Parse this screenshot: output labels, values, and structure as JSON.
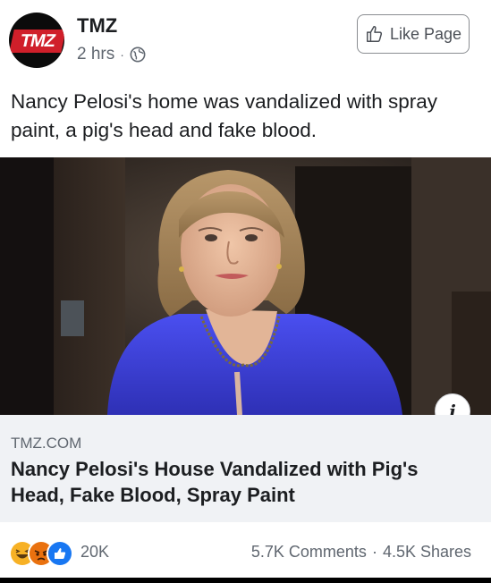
{
  "header": {
    "page_name": "TMZ",
    "avatar_logo": "TMZ",
    "timestamp": "2 hrs",
    "separator": "·",
    "audience_icon": "globe-icon",
    "like_page_label": "Like Page"
  },
  "post": {
    "text": "Nancy Pelosi's home was vandalized with spray paint, a pig's head and fake blood."
  },
  "link": {
    "domain": "TMZ.COM",
    "title": "Nancy Pelosi's House Vandalized with Pig's Head, Fake Blood, Spray Paint",
    "info_icon": "i"
  },
  "footer": {
    "reaction_icons": [
      "haha-icon",
      "angry-icon",
      "like-icon"
    ],
    "reaction_count": "20K",
    "comments": "5.7K Comments",
    "separator": "·",
    "shares": "4.5K Shares"
  },
  "colors": {
    "like_blue": "#1877f2",
    "angry_orange": "#e9710f",
    "haha_yellow": "#f7b125",
    "blazer_blue": "#3a3dd4"
  }
}
